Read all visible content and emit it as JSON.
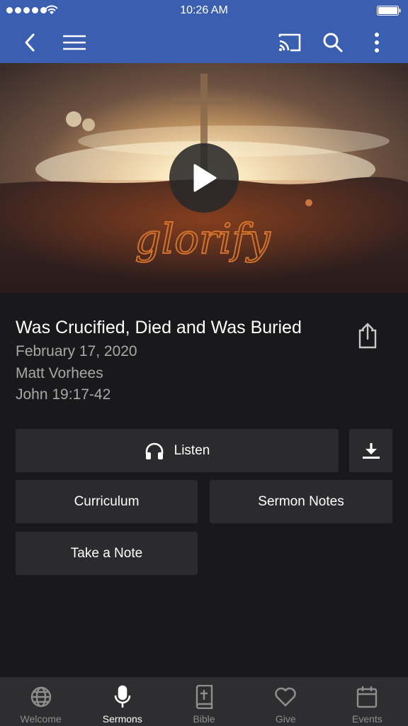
{
  "status_bar": {
    "time": "10:26 AM"
  },
  "hero": {
    "overlay_text": "glorify"
  },
  "sermon": {
    "title": "Was Crucified, Died and Was Buried",
    "date": "February 17, 2020",
    "speaker": "Matt Vorhees",
    "scripture": "John 19:17-42"
  },
  "actions": {
    "listen_label": "Listen",
    "curriculum_label": "Curriculum",
    "sermon_notes_label": "Sermon Notes",
    "take_note_label": "Take a Note"
  },
  "tabs": [
    {
      "label": "Welcome",
      "icon": "globe-icon",
      "active": false
    },
    {
      "label": "Sermons",
      "icon": "microphone-icon",
      "active": true
    },
    {
      "label": "Bible",
      "icon": "bible-icon",
      "active": false
    },
    {
      "label": "Give",
      "icon": "heart-icon",
      "active": false
    },
    {
      "label": "Events",
      "icon": "calendar-icon",
      "active": false
    }
  ],
  "colors": {
    "header": "#3a5fb0",
    "background": "#19191b",
    "button": "#2b2b2d",
    "tabbar": "#2e2e30",
    "meta_text": "#a8a8a8",
    "hero_script": "#e07a2e"
  }
}
